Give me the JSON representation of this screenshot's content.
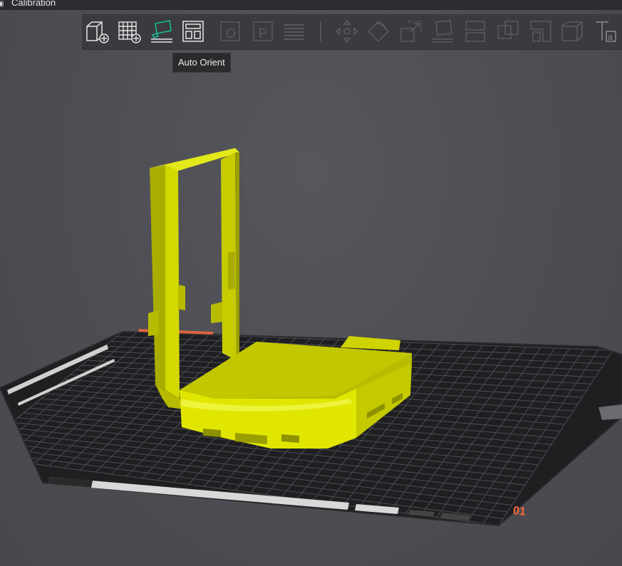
{
  "window": {
    "title": "Calibration"
  },
  "toolbar": {
    "buttons": [
      {
        "id": "add-object",
        "icon": "add-cube-icon",
        "enabled": true
      },
      {
        "id": "add-plate",
        "icon": "add-grid-icon",
        "enabled": true
      },
      {
        "id": "auto-orient",
        "icon": "auto-orient-icon",
        "enabled": true,
        "active": true
      },
      {
        "id": "arrange",
        "icon": "arrange-icon",
        "enabled": true
      },
      {
        "id": "split-objects",
        "icon": "split-objects-icon",
        "enabled": false
      },
      {
        "id": "split-parts",
        "icon": "split-parts-icon",
        "enabled": false
      },
      {
        "id": "layers",
        "icon": "layers-icon",
        "enabled": false
      },
      {
        "id": "move",
        "icon": "move-icon",
        "enabled": false
      },
      {
        "id": "rotate",
        "icon": "rotate-icon",
        "enabled": false
      },
      {
        "id": "scale",
        "icon": "scale-icon",
        "enabled": false
      },
      {
        "id": "lay-on-face",
        "icon": "lay-on-face-icon",
        "enabled": false
      },
      {
        "id": "cut",
        "icon": "cut-icon",
        "enabled": false
      },
      {
        "id": "mesh-boolean",
        "icon": "boolean-icon",
        "enabled": false
      },
      {
        "id": "support-paint",
        "icon": "support-paint-icon",
        "enabled": false
      },
      {
        "id": "seam-paint",
        "icon": "seam-paint-icon",
        "enabled": false
      },
      {
        "id": "text",
        "icon": "text-icon",
        "enabled": false
      }
    ],
    "tooltip": "Auto Orient"
  },
  "plate": {
    "number_label": "01",
    "colors": {
      "accent": "#ff6a3d",
      "model": "#d6dc00",
      "bed": "#1e1e21",
      "grid": "#55555a"
    }
  }
}
